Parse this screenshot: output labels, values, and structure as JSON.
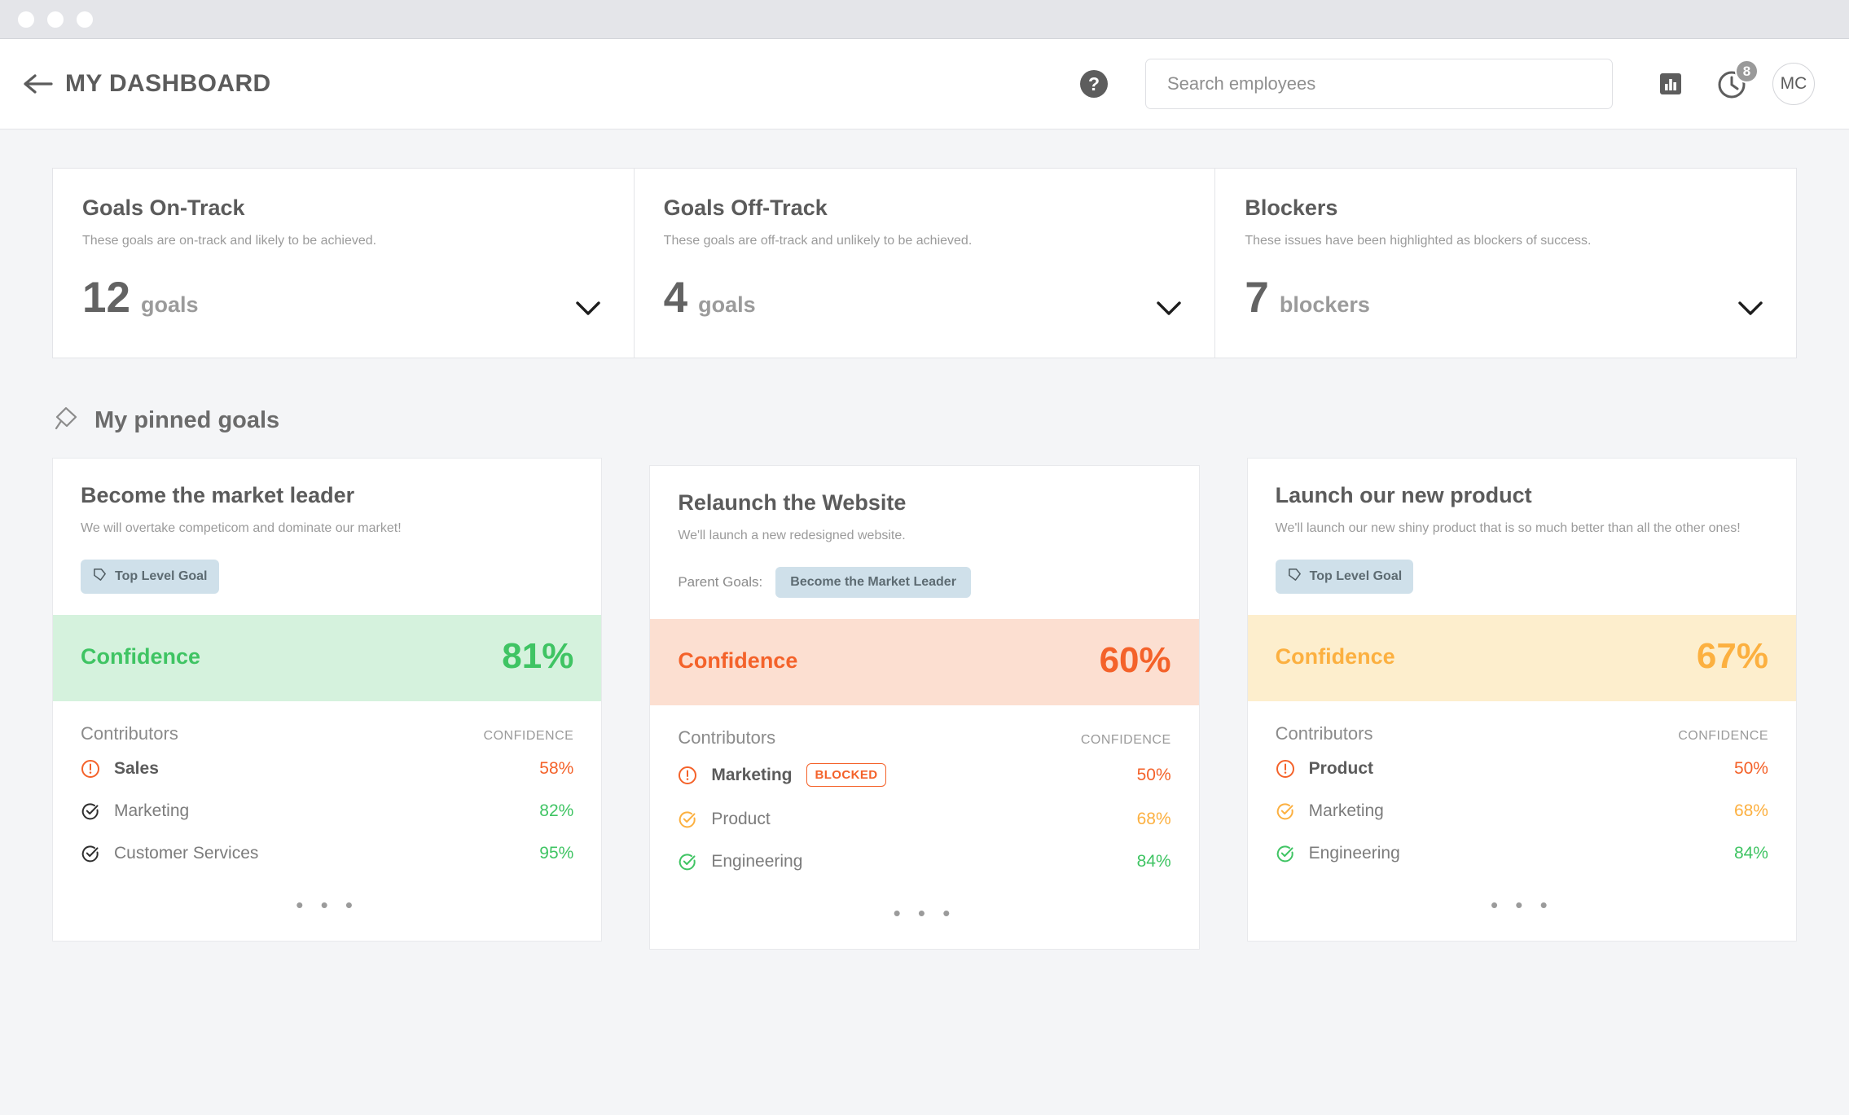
{
  "window": {
    "dots": [
      "close",
      "minimize",
      "maximize"
    ]
  },
  "header": {
    "back_icon": "arrow-left-icon",
    "title": "MY DASHBOARD",
    "help_label": "?",
    "search": {
      "placeholder": "Search employees",
      "value": ""
    },
    "reports_icon": "bar-chart-icon",
    "clock_icon": "clock-icon",
    "notification_count": "8",
    "avatar_initials": "MC"
  },
  "stats": [
    {
      "title": "Goals On-Track",
      "description": "These goals are on-track and likely to be achieved.",
      "value": "12",
      "unit": "goals",
      "chevron": "chevron-down-icon"
    },
    {
      "title": "Goals Off-Track",
      "description": "These goals are off-track and unlikely to be achieved.",
      "value": "4",
      "unit": "goals",
      "chevron": "chevron-down-icon"
    },
    {
      "title": "Blockers",
      "description": "These issues have been highlighted as blockers of success.",
      "value": "7",
      "unit": "blockers",
      "chevron": "chevron-down-icon"
    }
  ],
  "pinned_section": {
    "icon": "pin-icon",
    "title": "My pinned goals"
  },
  "colors": {
    "green": "#3fc463",
    "green_bg": "#d5f2dd",
    "orange": "#f4622a",
    "orange_bg": "#fcdfd1",
    "amber": "#fcb040",
    "amber_bg": "#fdeecd",
    "tag_bg": "#cfe0ea",
    "dark_icon": "#2f2f2f"
  },
  "goals": [
    {
      "title": "Become the market leader",
      "description": "We will overtake competicom and dominate our market!",
      "tag_type": "top_level",
      "tag_icon": "tag-icon",
      "tag_label": "Top Level Goal",
      "parent_label": "",
      "confidence_label": "Confidence",
      "confidence_value": "81%",
      "status": "green",
      "contributors_label": "Contributors",
      "confidence_column_label": "CONFIDENCE",
      "contributors": [
        {
          "icon": "alert-circle-icon",
          "icon_color": "orange",
          "name": "Sales",
          "emphasis": true,
          "badge": "",
          "pct": "58%",
          "pct_color": "orange"
        },
        {
          "icon": "check-circle-icon",
          "icon_color": "dark",
          "name": "Marketing",
          "emphasis": false,
          "badge": "",
          "pct": "82%",
          "pct_color": "green"
        },
        {
          "icon": "check-circle-icon",
          "icon_color": "dark",
          "name": "Customer Services",
          "emphasis": false,
          "badge": "",
          "pct": "95%",
          "pct_color": "green"
        }
      ],
      "more": "• • •"
    },
    {
      "title": "Relaunch the Website",
      "description": "We'll launch a new redesigned website.",
      "tag_type": "parent",
      "tag_icon": "",
      "tag_label": "Become the Market Leader",
      "parent_label": "Parent Goals:",
      "confidence_label": "Confidence",
      "confidence_value": "60%",
      "status": "orange",
      "contributors_label": "Contributors",
      "confidence_column_label": "CONFIDENCE",
      "contributors": [
        {
          "icon": "alert-circle-icon",
          "icon_color": "orange",
          "name": "Marketing",
          "emphasis": true,
          "badge": "BLOCKED",
          "pct": "50%",
          "pct_color": "orange"
        },
        {
          "icon": "check-circle-icon",
          "icon_color": "amber",
          "name": "Product",
          "emphasis": false,
          "badge": "",
          "pct": "68%",
          "pct_color": "amber"
        },
        {
          "icon": "check-circle-icon",
          "icon_color": "green",
          "name": "Engineering",
          "emphasis": false,
          "badge": "",
          "pct": "84%",
          "pct_color": "green"
        }
      ],
      "more": "• • •"
    },
    {
      "title": "Launch our new product",
      "description": "We'll launch our new shiny product that is so much better than all the other ones!",
      "tag_type": "top_level",
      "tag_icon": "tag-icon",
      "tag_label": "Top Level Goal",
      "parent_label": "",
      "confidence_label": "Confidence",
      "confidence_value": "67%",
      "status": "amber",
      "contributors_label": "Contributors",
      "confidence_column_label": "CONFIDENCE",
      "contributors": [
        {
          "icon": "alert-circle-icon",
          "icon_color": "orange",
          "name": "Product",
          "emphasis": true,
          "badge": "",
          "pct": "50%",
          "pct_color": "orange"
        },
        {
          "icon": "check-circle-icon",
          "icon_color": "amber",
          "name": "Marketing",
          "emphasis": false,
          "badge": "",
          "pct": "68%",
          "pct_color": "amber"
        },
        {
          "icon": "check-circle-icon",
          "icon_color": "green",
          "name": "Engineering",
          "emphasis": false,
          "badge": "",
          "pct": "84%",
          "pct_color": "green"
        }
      ],
      "more": "• • •"
    }
  ]
}
